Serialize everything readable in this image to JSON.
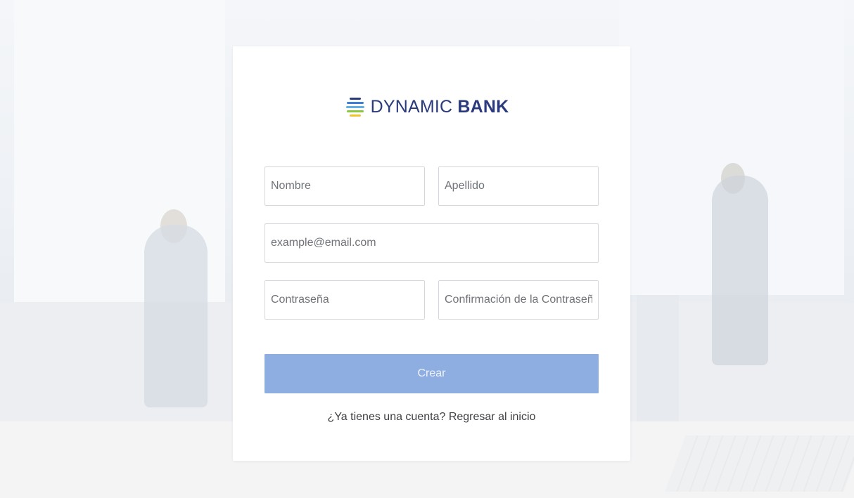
{
  "brand": {
    "name_thin": "DYNAMIC",
    "name_bold": "BANK",
    "icon": "striped-globe-icon",
    "colors": {
      "text": "#2b3a7c",
      "stripes": [
        "#2b3a7c",
        "#3d7fd1",
        "#5fb0e6",
        "#8cc63f",
        "#f2c230"
      ]
    }
  },
  "form": {
    "first_name": {
      "placeholder": "Nombre",
      "value": ""
    },
    "last_name": {
      "placeholder": "Apellido",
      "value": ""
    },
    "email": {
      "placeholder": "example@email.com",
      "value": ""
    },
    "password": {
      "placeholder": "Contraseña",
      "value": ""
    },
    "password_confirm": {
      "placeholder": "Confirmación de la Contraseña",
      "value": ""
    },
    "submit_label": "Crear"
  },
  "footer": {
    "prompt": "¿Ya tienes una cuenta?",
    "link_label": "Regresar al inicio"
  },
  "theme": {
    "button_color": "#8eaee2",
    "card_color": "#ffffff"
  }
}
